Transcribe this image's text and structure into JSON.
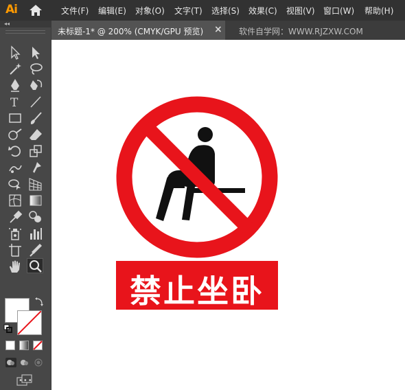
{
  "app": {
    "logo": "Ai"
  },
  "menu": [
    "文件(F)",
    "编辑(E)",
    "对象(O)",
    "文字(T)",
    "选择(S)",
    "效果(C)",
    "视图(V)",
    "窗口(W)",
    "帮助(H)"
  ],
  "tabs": {
    "active": "未标题-1* @ 200% (CMYK/GPU 预览)",
    "close": "×",
    "inactive": "软件自学网：WWW.RJZXW.COM"
  },
  "toolbar": {
    "collapse": "◂◂",
    "more": "•••"
  },
  "sign": {
    "text": "禁止坐卧",
    "colors": {
      "red": "#e8141b",
      "figure": "#111111",
      "background": "#ffffff"
    }
  },
  "icons": [
    "home-icon",
    "selection-tool-icon",
    "direct-selection-tool-icon",
    "magic-wand-icon",
    "lasso-icon",
    "pen-icon",
    "curvature-icon",
    "type-icon",
    "line-icon",
    "rectangle-icon",
    "paintbrush-icon",
    "shaper-icon",
    "eraser-icon",
    "rotate-icon",
    "scale-icon",
    "puppet-warp-icon",
    "free-transform-icon",
    "shape-builder-icon",
    "perspective-grid-icon",
    "mesh-icon",
    "gradient-icon",
    "eyedropper-icon",
    "blend-icon",
    "symbol-sprayer-icon",
    "column-graph-icon",
    "artboard-icon",
    "slice-icon",
    "hand-icon",
    "zoom-icon"
  ]
}
